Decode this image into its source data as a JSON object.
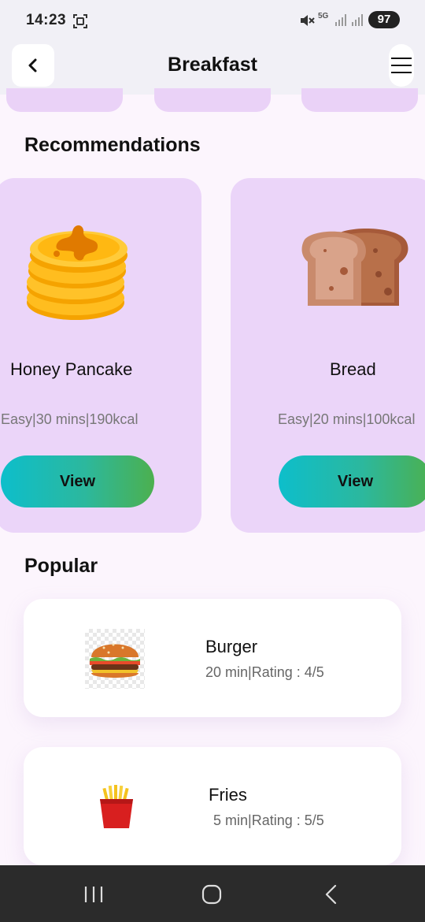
{
  "status_bar": {
    "time": "14:23",
    "network": "5G",
    "battery": "97",
    "icons": [
      "screenshot-icon",
      "mute-icon",
      "signal-icon",
      "signal-icon",
      "battery-icon"
    ]
  },
  "header": {
    "title": "Breakfast",
    "back_icon": "chevron-left-icon",
    "menu_icon": "hamburger-icon"
  },
  "recommendations": {
    "title": "Recommendations",
    "items": [
      {
        "name": "Honey Pancake",
        "meta": "Easy|30 mins|190kcal",
        "button": "View",
        "icon": "pancake-icon"
      },
      {
        "name": "Bread",
        "meta": "Easy|20 mins|100kcal",
        "button": "View",
        "icon": "bread-icon"
      }
    ]
  },
  "popular": {
    "title": "Popular",
    "items": [
      {
        "name": "Burger",
        "meta": "20 min|Rating : 4/5",
        "icon": "burger-icon"
      },
      {
        "name": "Fries",
        "meta": "5 min|Rating : 5/5",
        "icon": "fries-icon"
      }
    ]
  },
  "colors": {
    "card_purple": "#ebd5f9",
    "button_gradient_start": "#0dbecb",
    "button_gradient_end": "#4cb04f",
    "page_background": "#fcf5fd"
  }
}
